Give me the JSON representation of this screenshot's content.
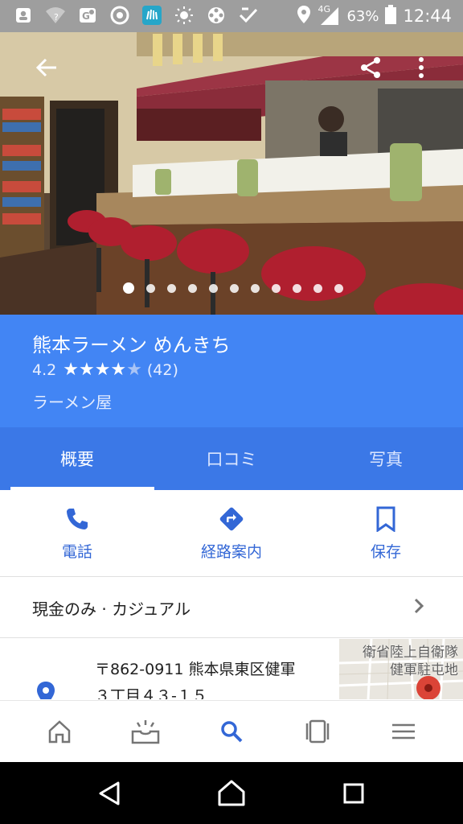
{
  "status_bar": {
    "network": "4G",
    "battery": "63%",
    "time": "12:44",
    "left_icons": [
      "contacts-icon",
      "wifi-question-icon",
      "maps-icon",
      "chrome-icon",
      "app-badge-icon",
      "brightness-icon",
      "film-icon",
      "checkmark-icon"
    ],
    "right_icons": [
      "location-icon",
      "signal-icon",
      "battery-icon"
    ]
  },
  "hero": {
    "photo_count": 11,
    "active_photo": 1,
    "back_icon": "arrow-back-icon",
    "share_icon": "share-icon",
    "more_icon": "more-vert-icon"
  },
  "place": {
    "name": "熊本ラーメン めんきち",
    "rating": "4.2",
    "rating_value": 4.2,
    "reviews": "(42)",
    "category": "ラーメン屋"
  },
  "tabs": [
    {
      "label": "概要",
      "active": true
    },
    {
      "label": "口コミ",
      "active": false
    },
    {
      "label": "写真",
      "active": false
    }
  ],
  "actions": [
    {
      "label": "電話",
      "icon": "phone-icon"
    },
    {
      "label": "経路案内",
      "icon": "directions-icon"
    },
    {
      "label": "保存",
      "icon": "bookmark-icon"
    }
  ],
  "attributes": {
    "text": "現金のみ · カジュアル"
  },
  "address": {
    "line1": "〒862-0911 熊本県東区健軍",
    "line2": "３丁目４３-１５",
    "map_label_1": "衛省陸上自衛隊",
    "map_label_2": "健軍駐屯地"
  },
  "bottom_nav": [
    "home-icon",
    "inbox-icon",
    "search-icon",
    "cards-icon",
    "menu-icon"
  ],
  "system_nav": [
    "back-triangle-icon",
    "home-circle-icon",
    "recents-square-icon"
  ],
  "colors": {
    "accent": "#4285f4",
    "tab_bar": "#3b78e7",
    "action_blue": "#3367d6",
    "status_bar": "#9e9e9e"
  }
}
